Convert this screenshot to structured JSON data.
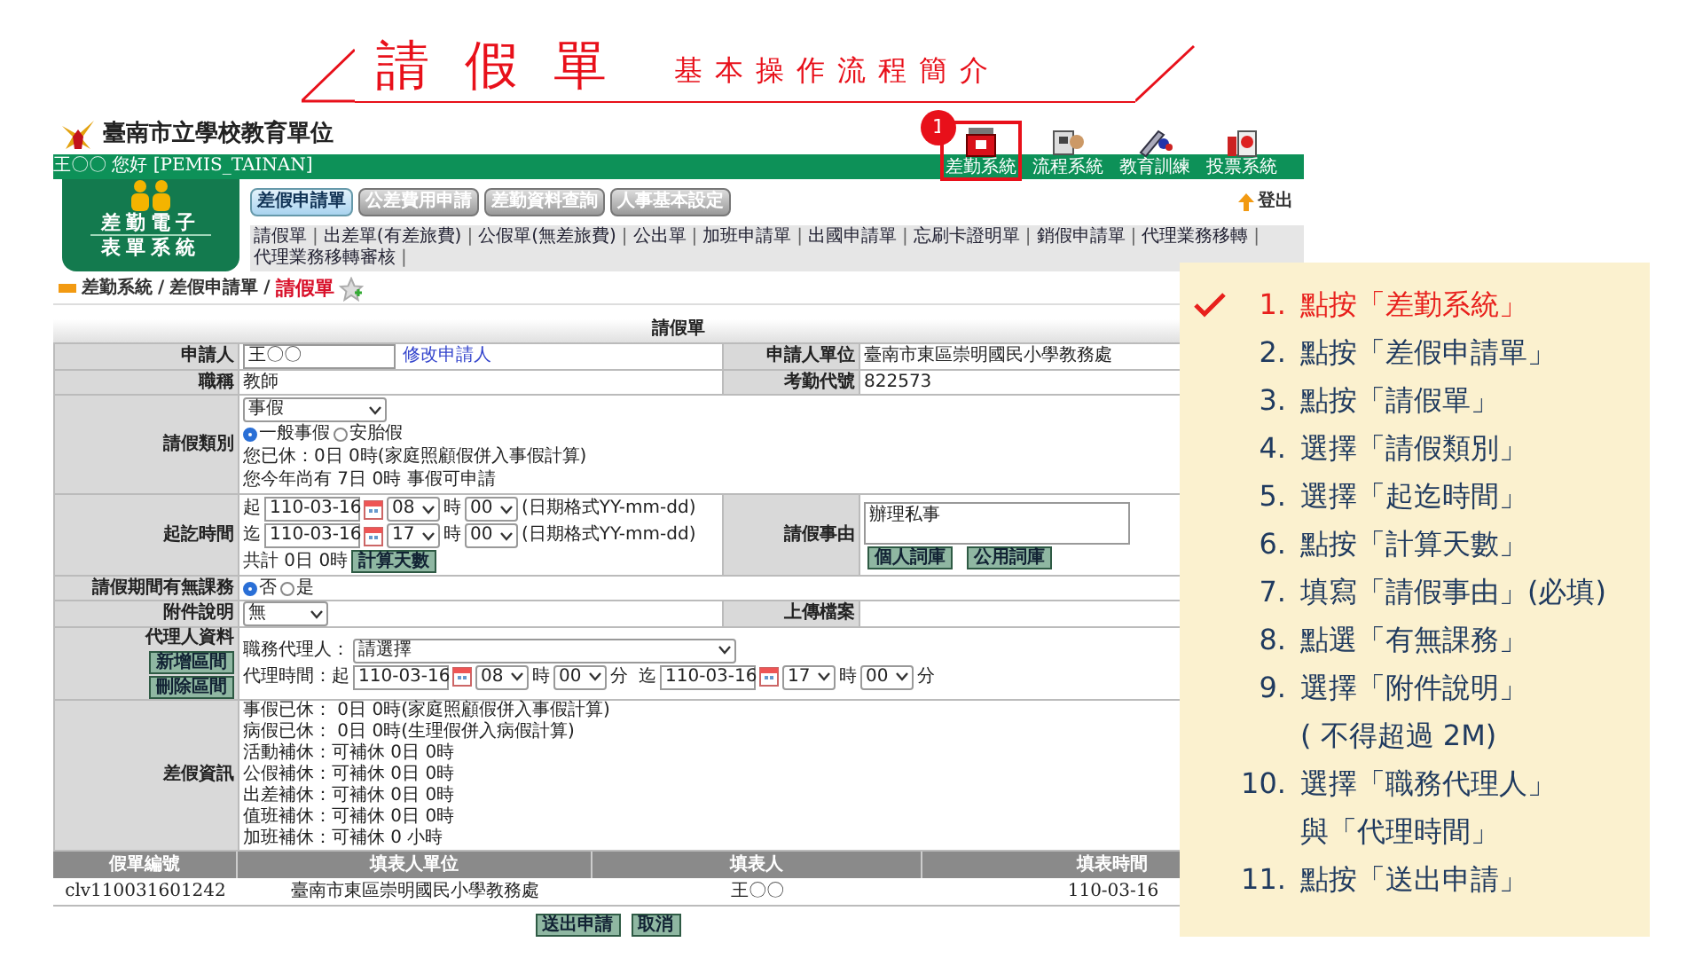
{
  "slide_title": {
    "main": "請假單",
    "sub": "基本操作流程簡介"
  },
  "header": {
    "org": "臺南市立學校教育單位",
    "greeting": "王〇〇 您好 [PEMIS_TAINAN]",
    "callout": "1",
    "logout": "登出",
    "systems": [
      {
        "label": "差勤系統",
        "highlighted": true
      },
      {
        "label": "流程系統",
        "highlighted": false
      },
      {
        "label": "教育訓練",
        "highlighted": false
      },
      {
        "label": "投票系統",
        "highlighted": false
      }
    ]
  },
  "app_logo": {
    "line1": "差勤電子",
    "line2": "表單系統"
  },
  "tabs": [
    {
      "label": "差假申請單",
      "selected": true
    },
    {
      "label": "公差費用申請",
      "selected": false
    },
    {
      "label": "差勤資料查詢",
      "selected": false
    },
    {
      "label": "人事基本設定",
      "selected": false
    }
  ],
  "link_separator": "|",
  "links": [
    "請假單",
    "出差單(有差旅費)",
    "公假單(無差旅費)",
    "公出單",
    "加班申請單",
    "出國申請單",
    "忘刷卡證明單",
    "銷假申請單",
    "代理業務移轉",
    "代理業務移轉審核"
  ],
  "breadcrumb": {
    "separator": "/",
    "items": [
      {
        "label": "差勤系統",
        "current": false
      },
      {
        "label": "差假申請單",
        "current": false
      },
      {
        "label": "請假單",
        "current": true
      }
    ]
  },
  "form": {
    "title": "請假單",
    "applicant": {
      "label": "申請人",
      "value": "王〇〇",
      "link": "修改申請人"
    },
    "unit": {
      "label": "申請人單位",
      "value": "臺南市東區崇明國民小學教務處"
    },
    "job_title": {
      "label": "職稱",
      "value": "教師"
    },
    "attendance_code": {
      "label": "考勤代號",
      "value": "822573"
    },
    "leave_type": {
      "label": "請假類別",
      "select": "事假",
      "options": [
        {
          "label": "一般事假",
          "selected": true
        },
        {
          "label": "安胎假",
          "selected": false
        }
      ],
      "notes": [
        "您已休：0日 0時(家庭照顧假併入事假計算)",
        "您今年尚有 7日 0時 事假可申請"
      ]
    },
    "period": {
      "label": "起訖時間",
      "rows": [
        {
          "prefix": "起",
          "date": "110-03-16",
          "hour": "08",
          "hour_unit": "時",
          "minute": "00",
          "hint": "(日期格式YY-mm-dd)"
        },
        {
          "prefix": "迄",
          "date": "110-03-16",
          "hour": "17",
          "hour_unit": "時",
          "minute": "00",
          "hint": "(日期格式YY-mm-dd)"
        }
      ],
      "total": "共計  0日 0時",
      "calc_button": "計算天數"
    },
    "reason": {
      "label": "請假事由",
      "value": "辦理私事",
      "buttons": [
        "個人詞庫",
        "公用詞庫"
      ]
    },
    "classes": {
      "label": "請假期間有無課務",
      "options": [
        {
          "label": "否",
          "selected": true
        },
        {
          "label": "是",
          "selected": false
        }
      ]
    },
    "attachment": {
      "label": "附件說明",
      "select": "無"
    },
    "upload": {
      "label": "上傳檔案"
    },
    "agent": {
      "label": "代理人資料",
      "buttons": [
        "新增區間",
        "刪除區間"
      ],
      "agent_label": "職務代理人：",
      "agent_select": "請選擇",
      "time_label": "代理時間：起",
      "to": "迄",
      "start": {
        "date": "110-03-16",
        "hour": "08",
        "hour_unit": "時",
        "minute": "00",
        "minute_unit": "分"
      },
      "end": {
        "date": "110-03-16",
        "hour": "17",
        "hour_unit": "時",
        "minute": "00",
        "minute_unit": "分"
      }
    },
    "leave_info": {
      "label": "差假資訊",
      "lines": [
        "事假已休： 0日 0時(家庭照顧假併入事假計算)",
        "病假已休： 0日 0時(生理假併入病假計算)",
        "活動補休：可補休 0日 0時",
        "公假補休：可補休 0日 0時",
        "出差補休：可補休 0日 0時",
        "值班補休：可補休 0日 0時",
        "加班補休：可補休 0 小時"
      ]
    }
  },
  "record_table": {
    "columns": [
      "假單編號",
      "填表人單位",
      "填表人",
      "填表時間"
    ],
    "rows": [
      [
        "clv110031601242",
        "臺南市東區崇明國民小學教務處",
        "王〇〇",
        "110-03-16"
      ]
    ]
  },
  "actions": [
    "送出申請",
    "取消"
  ],
  "steps": [
    {
      "number": "1.",
      "text": "點按「差勤系統」",
      "current": true
    },
    {
      "number": "2.",
      "text": "點按「差假申請單」",
      "current": false
    },
    {
      "number": "3.",
      "text": "點按「請假單」",
      "current": false
    },
    {
      "number": "4.",
      "text": "選擇「請假類別」",
      "current": false
    },
    {
      "number": "5.",
      "text": "選擇「起迄時間」",
      "current": false
    },
    {
      "number": "6.",
      "text": "點按「計算天數」",
      "current": false
    },
    {
      "number": "7.",
      "text": "填寫「請假事由」(必填)",
      "current": false
    },
    {
      "number": "8.",
      "text": "點選「有無課務」",
      "current": false
    },
    {
      "number": "9.",
      "text": "選擇「附件說明」",
      "note": "( 不得超過 2M)",
      "current": false
    },
    {
      "number": "10.",
      "text": "選擇「職務代理人」",
      "note": "與「代理時間」",
      "current": false
    },
    {
      "number": "11.",
      "text": "點按「送出申請」",
      "current": false
    }
  ]
}
